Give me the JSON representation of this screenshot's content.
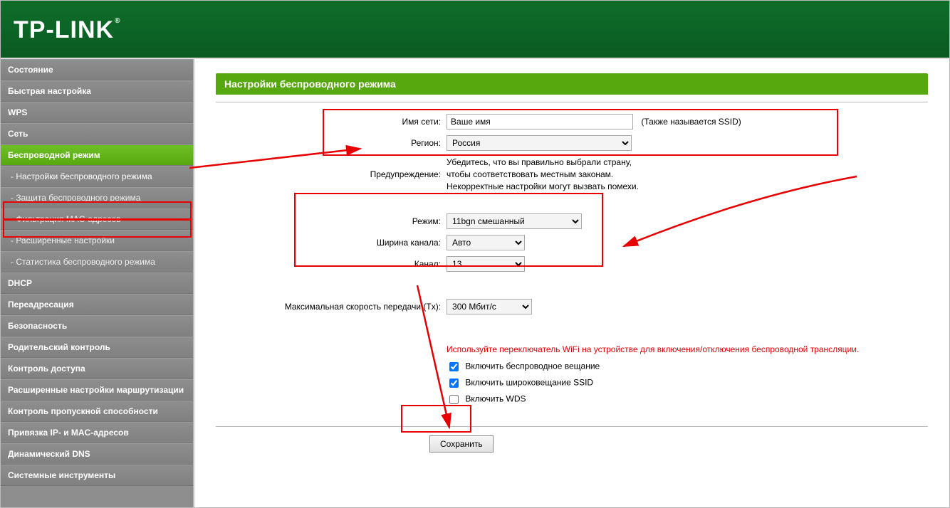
{
  "brand": "TP-LINK",
  "sidebar": {
    "items": [
      {
        "label": "Состояние",
        "type": "top"
      },
      {
        "label": "Быстрая настройка",
        "type": "top"
      },
      {
        "label": "WPS",
        "type": "top"
      },
      {
        "label": "Сеть",
        "type": "top"
      },
      {
        "label": "Беспроводной режим",
        "type": "top",
        "active": true
      },
      {
        "label": "- Настройки беспроводного режима",
        "type": "sub",
        "active": true
      },
      {
        "label": "- Защита беспроводного режима",
        "type": "sub"
      },
      {
        "label": "- Фильтрация MAC-адресов",
        "type": "sub"
      },
      {
        "label": "- Расширенные настройки",
        "type": "sub"
      },
      {
        "label": "- Статистика беспроводного режима",
        "type": "sub"
      },
      {
        "label": "DHCP",
        "type": "top"
      },
      {
        "label": "Переадресация",
        "type": "top"
      },
      {
        "label": "Безопасность",
        "type": "top"
      },
      {
        "label": "Родительский контроль",
        "type": "top"
      },
      {
        "label": "Контроль доступа",
        "type": "top"
      },
      {
        "label": "Расширенные настройки маршрутизации",
        "type": "top"
      },
      {
        "label": "Контроль пропускной способности",
        "type": "top"
      },
      {
        "label": "Привязка IP- и MAC-адресов",
        "type": "top"
      },
      {
        "label": "Динамический DNS",
        "type": "top"
      },
      {
        "label": "Системные инструменты",
        "type": "top"
      }
    ]
  },
  "page": {
    "title": "Настройки беспроводного режима",
    "ssid_label": "Имя сети:",
    "ssid_value": "Ваше имя",
    "ssid_note": "(Также называется SSID)",
    "region_label": "Регион:",
    "region_value": "Россия",
    "warn_label": "Предупреждение:",
    "warn_line1": "Убедитесь, что вы правильно выбрали страну,",
    "warn_line2": "чтобы соответствовать местным законам.",
    "warn_line3": "Некорректные настройки могут вызвать помехи.",
    "mode_label": "Режим:",
    "mode_value": "11bgn смешанный",
    "chwidth_label": "Ширина канала:",
    "chwidth_value": "Авто",
    "channel_label": "Канал:",
    "channel_value": "13",
    "maxrate_label": "Максимальная скорость передачи (Tx):",
    "maxrate_value": "300 Мбит/с",
    "wifi_switch_note": "Используйте переключатель WiFi на устройстве для включения/отключения беспроводной трансляции.",
    "chk1_label": "Включить беспроводное вещание",
    "chk1_checked": true,
    "chk2_label": "Включить широковещание SSID",
    "chk2_checked": true,
    "chk3_label": "Включить WDS",
    "chk3_checked": false,
    "save_label": "Сохранить"
  }
}
